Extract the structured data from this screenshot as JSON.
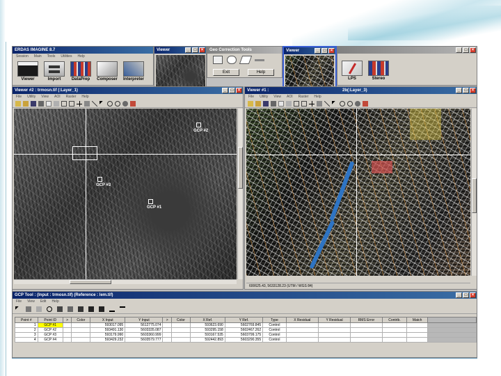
{
  "slide": {
    "accent": "#5c8fb0"
  },
  "main_window": {
    "title": "ERDAS IMAGINE 8.7",
    "menu": [
      "Session",
      "Main",
      "Tools",
      "Utilities",
      "Help"
    ],
    "tools": [
      {
        "label": "Viewer",
        "icon": "viewer-icon"
      },
      {
        "label": "Import",
        "icon": "import-icon"
      },
      {
        "label": "DataPrep",
        "icon": "dataprep-icon"
      },
      {
        "label": "Composer",
        "icon": "composer-icon"
      },
      {
        "label": "Interpreter",
        "icon": "interpreter-icon"
      }
    ],
    "right_tools": [
      {
        "label": "LPS",
        "icon": "lps-icon"
      },
      {
        "label": "Stereo",
        "icon": "stereo-icon"
      }
    ]
  },
  "thumb_viewer_left": {
    "title": "Viewer"
  },
  "thumb_viewer_right": {
    "title": "Viewer"
  },
  "gcp_tool_ref": {
    "title": "Geo Correction Tools",
    "exit_label": "Exit",
    "help_label": "Help"
  },
  "viewer1": {
    "title": "Viewer #2 : trmosn.tif (:Layer_1)",
    "menu": [
      "File",
      "Utility",
      "View",
      "AOI",
      "Raster",
      "Help"
    ],
    "gcp_labels": [
      "GCP #2",
      "GCP #3",
      "GCP #1"
    ]
  },
  "viewer2": {
    "title": "Viewer #1 : ",
    "title_tail": "2b(:Layer_3)",
    "menu": [
      "File",
      "Utility",
      "View",
      "AOI",
      "Raster",
      "Help"
    ],
    "status": "600625.43, 5633128.23  (UTM / WGS 84)"
  },
  "gcp_editor": {
    "title": "GCP Tool : (Input : trmosn.tif) (Reference : lem.tif)",
    "menu": [
      "File",
      "View",
      "Edit",
      "Help"
    ],
    "columns": [
      "Point #",
      "Point ID",
      ">",
      "Color",
      "X Input",
      "Y Input",
      ">",
      "Color",
      "X Ref.",
      "Y Ref.",
      "Type",
      "X Residual",
      "Y Residual",
      "RMS Error",
      "Contrib.",
      "Match"
    ],
    "rows": [
      {
        "num": "1",
        "id": "GCP #1",
        "xin": "593017.095",
        "yin": "5612775.074",
        "xref": "593623.690",
        "yref": "5602769.845",
        "type": "Control"
      },
      {
        "num": "2",
        "id": "GCP #2",
        "xin": "593491.130",
        "yin": "5603335.087",
        "xref": "593295.158",
        "yref": "5602467.262",
        "type": "Control"
      },
      {
        "num": "3",
        "id": "GCP #3",
        "xin": "593179.990",
        "yin": "5603360.999",
        "xref": "593167.535",
        "yref": "5603799.175",
        "type": "Control"
      },
      {
        "num": "4",
        "id": "GCP #4",
        "xin": "593429.232",
        "yin": "5603579.777",
        "xref": "592442.893",
        "yref": "5603290.355",
        "type": "Control"
      }
    ]
  }
}
